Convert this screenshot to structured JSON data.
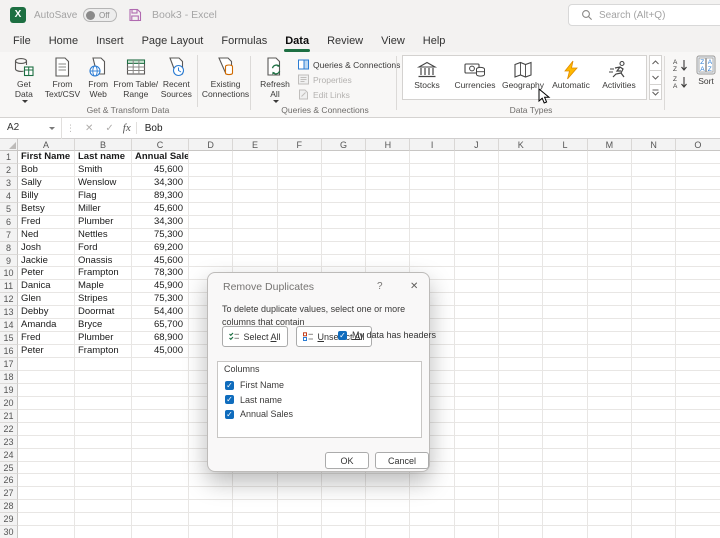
{
  "titlebar": {
    "autosave": "AutoSave",
    "autosave_state": "Off",
    "doc_title": "Book3  -  Excel",
    "search_placeholder": "Search (Alt+Q)",
    "logo_letter": "X"
  },
  "menu": {
    "tabs": [
      "File",
      "Home",
      "Insert",
      "Page Layout",
      "Formulas",
      "Data",
      "Review",
      "View",
      "Help"
    ],
    "active": "Data"
  },
  "ribbon": {
    "get_data": "Get\nData",
    "from_text_csv": "From\nText/CSV",
    "from_web": "From\nWeb",
    "from_table_range": "From Table/\nRange",
    "recent_sources": "Recent\nSources",
    "existing_connections": "Existing\nConnections",
    "group1_label": "Get & Transform Data",
    "refresh_all": "Refresh\nAll",
    "queries_connections": "Queries & Connections",
    "properties": "Properties",
    "edit_links": "Edit Links",
    "group2_label": "Queries & Connections",
    "stocks": "Stocks",
    "currencies": "Currencies",
    "geography": "Geography",
    "automatic": "Automatic",
    "activities": "Activities",
    "group3_label": "Data Types",
    "sort": "Sort"
  },
  "formula_bar": {
    "name_box": "A2",
    "dots": "⋮",
    "cancel_glyph": "✕",
    "enter_glyph": "✓",
    "fx": "fx",
    "content": "Bob"
  },
  "grid": {
    "columns": [
      "A",
      "B",
      "C",
      "D",
      "E",
      "F",
      "G",
      "H",
      "I",
      "J",
      "K",
      "L",
      "M",
      "N",
      "O"
    ],
    "visible_rows": 30,
    "rows": [
      [
        "First Name",
        "Last name",
        "Annual Sales"
      ],
      [
        "Bob",
        "Smith",
        "45,600"
      ],
      [
        "Sally",
        "Wenslow",
        "34,300"
      ],
      [
        "Billy",
        "Flag",
        "89,300"
      ],
      [
        "Betsy",
        "Miller",
        "45,600"
      ],
      [
        "Fred",
        "Plumber",
        "34,300"
      ],
      [
        "Ned",
        "Nettles",
        "75,300"
      ],
      [
        "Josh",
        "Ford",
        "69,200"
      ],
      [
        "Jackie",
        "Onassis",
        "45,600"
      ],
      [
        "Peter",
        "Frampton",
        "78,300"
      ],
      [
        "Danica",
        "Maple",
        "45,900"
      ],
      [
        "Glen",
        "Stripes",
        "75,300"
      ],
      [
        "Debby",
        "Doormat",
        "54,400"
      ],
      [
        "Amanda",
        "Bryce",
        "65,700"
      ],
      [
        "Fred",
        "Plumber",
        "68,900"
      ],
      [
        "Peter",
        "Frampton",
        "45,000"
      ]
    ]
  },
  "dialog": {
    "title": "Remove Duplicates",
    "help_glyph": "?",
    "close_glyph": "✕",
    "description": "To delete duplicate values, select one or more columns that contain\nduplicates.",
    "select_all": {
      "label": "Select All",
      "accel": "A"
    },
    "unselect_all": {
      "label": "Unselect All",
      "accel": "U"
    },
    "headers_checkbox": {
      "label": "My data has headers",
      "accel": "M"
    },
    "columns_label": "Columns",
    "column_items": [
      "First Name",
      "Last name",
      "Annual Sales"
    ],
    "ok": "OK",
    "cancel": "Cancel"
  }
}
